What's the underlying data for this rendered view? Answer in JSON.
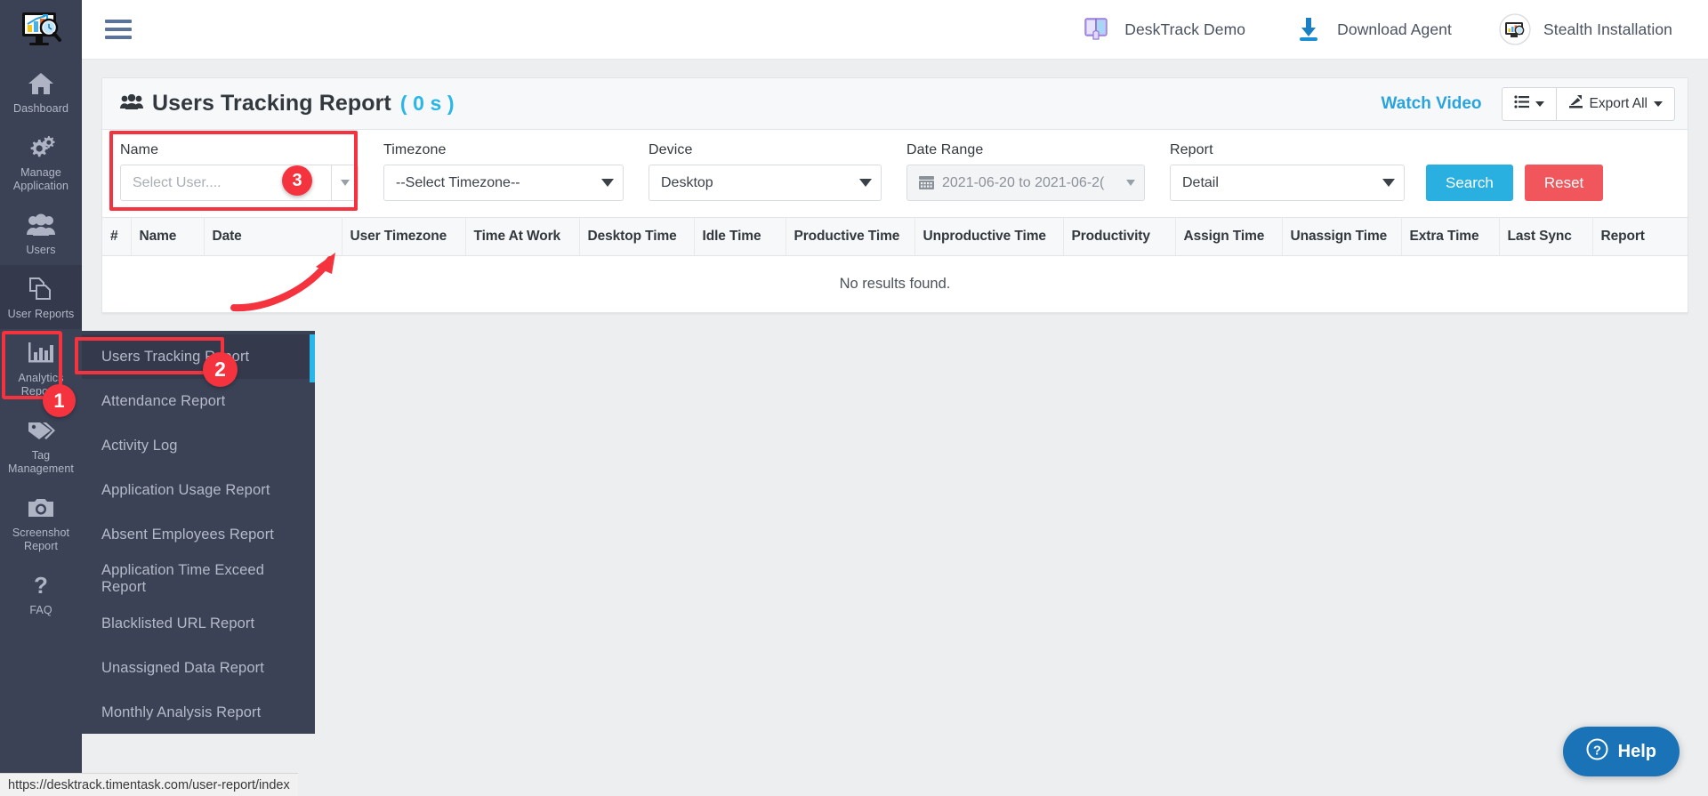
{
  "rail": {
    "logo_icon": "desktrack-logo-icon",
    "items": [
      {
        "label": "Dashboard",
        "icon": "home-icon",
        "active": false
      },
      {
        "label": "Manage Application",
        "icon": "gears-icon",
        "active": false
      },
      {
        "label": "Users",
        "icon": "users-icon",
        "active": false
      },
      {
        "label": "User Reports",
        "icon": "copy-files-icon",
        "active": true
      },
      {
        "label": "Analytics Reports",
        "icon": "bar-chart-icon",
        "active": false
      },
      {
        "label": "Tag Management",
        "icon": "tags-icon",
        "active": false
      },
      {
        "label": "Screenshot Report",
        "icon": "camera-icon",
        "active": false
      },
      {
        "label": "FAQ",
        "icon": "question-mark-icon",
        "active": false
      }
    ]
  },
  "submenu": {
    "items": [
      {
        "label": "Users Tracking Report",
        "active": true
      },
      {
        "label": "Attendance Report",
        "active": false
      },
      {
        "label": "Activity Log",
        "active": false
      },
      {
        "label": "Application Usage Report",
        "active": false
      },
      {
        "label": "Absent Employees Report",
        "active": false
      },
      {
        "label": "Application Time Exceed Report",
        "active": false
      },
      {
        "label": "Blacklisted URL Report",
        "active": false
      },
      {
        "label": "Unassigned Data Report",
        "active": false
      },
      {
        "label": "Monthly Analysis Report",
        "active": false
      }
    ]
  },
  "topbar": {
    "menu_toggle_icon": "hamburger-icon",
    "actions": [
      {
        "label": "DeskTrack Demo",
        "icon": "book-hand-icon"
      },
      {
        "label": "Download Agent",
        "icon": "download-icon"
      },
      {
        "label": "Stealth Installation",
        "icon": "stealth-monitor-icon"
      }
    ]
  },
  "card": {
    "title": "Users Tracking Report",
    "title_icon": "users-group-icon",
    "count": "( 0 s )",
    "watch_video": "Watch Video",
    "columns_button_icon": "list-columns-icon",
    "export_button": "Export All",
    "export_icon": "export-icon"
  },
  "filters": {
    "name": {
      "label": "Name",
      "placeholder": "Select User....",
      "value": ""
    },
    "timezone": {
      "label": "Timezone",
      "value": "--Select Timezone--"
    },
    "device": {
      "label": "Device",
      "value": "Desktop"
    },
    "date_range": {
      "label": "Date Range",
      "value": "2021-06-20 to 2021-06-2(",
      "icon": "calendar-icon"
    },
    "report": {
      "label": "Report",
      "value": "Detail"
    },
    "search_button": "Search",
    "reset_button": "Reset"
  },
  "table": {
    "columns": [
      "#",
      "Name",
      "Date",
      "User Timezone",
      "Time At Work",
      "Desktop Time",
      "Idle Time",
      "Productive Time",
      "Unproductive Time",
      "Productivity",
      "Assign Time",
      "Unassign Time",
      "Extra Time",
      "Last Sync",
      "Report"
    ],
    "empty_message": "No results found."
  },
  "annotations": {
    "step1": "1",
    "step2": "2",
    "step3": "3"
  },
  "help": {
    "label": "Help",
    "icon": "question-circle-icon"
  },
  "statusbar": {
    "url": "https://desktrack.timentask.com/user-report/index"
  },
  "colors": {
    "accent": "#29b6e8",
    "rail_bg": "#3b4256",
    "annotation_red": "#f5333f",
    "search_blue": "#29b0e0",
    "reset_red": "#f0565b",
    "help_blue": "#1a73b7"
  }
}
